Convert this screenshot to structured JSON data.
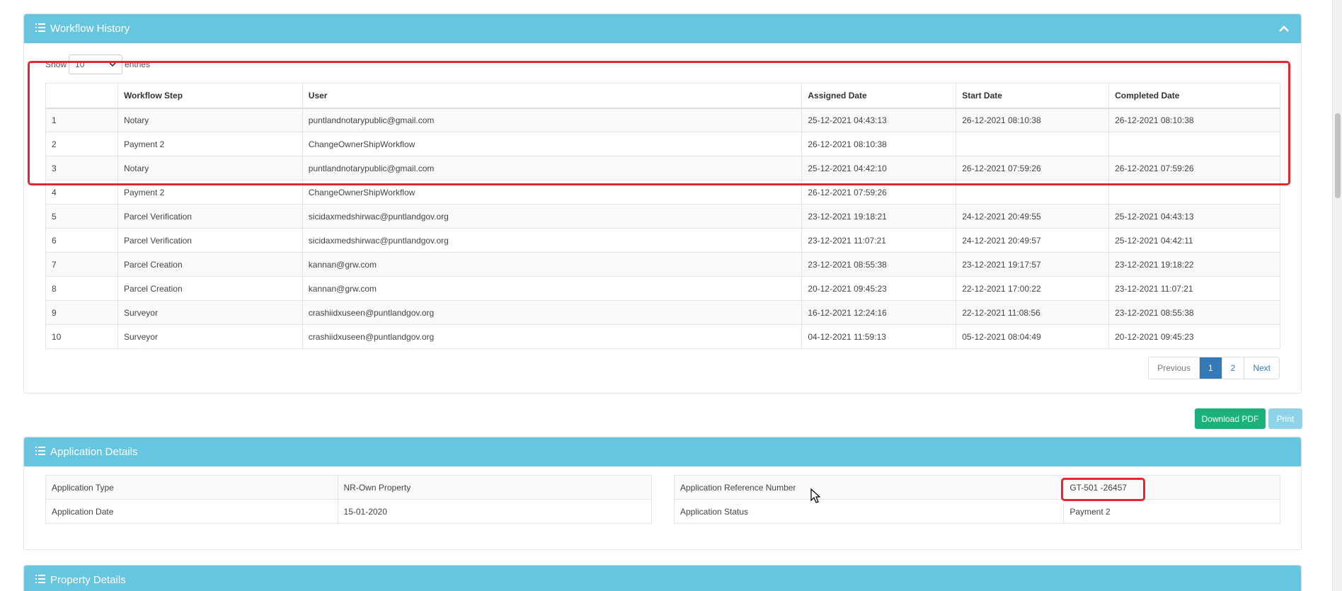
{
  "workflow_history": {
    "title": "Workflow History",
    "show_label": "Show",
    "entries_value": "10",
    "entries_label": "entries",
    "columns": [
      "",
      "Workflow Step",
      "User",
      "Assigned Date",
      "Start Date",
      "Completed Date"
    ],
    "rows": [
      [
        "1",
        "Notary",
        "puntlandnotarypublic@gmail.com",
        "25-12-2021 04:43:13",
        "26-12-2021 08:10:38",
        "26-12-2021 08:10:38"
      ],
      [
        "2",
        "Payment 2",
        "ChangeOwnerShipWorkflow",
        "26-12-2021 08:10:38",
        "",
        ""
      ],
      [
        "3",
        "Notary",
        "puntlandnotarypublic@gmail.com",
        "25-12-2021 04:42:10",
        "26-12-2021 07:59:26",
        "26-12-2021 07:59:26"
      ],
      [
        "4",
        "Payment 2",
        "ChangeOwnerShipWorkflow",
        "26-12-2021 07:59:26",
        "",
        ""
      ],
      [
        "5",
        "Parcel Verification",
        "sicidaxmedshirwac@puntlandgov.org",
        "23-12-2021 19:18:21",
        "24-12-2021 20:49:55",
        "25-12-2021 04:43:13"
      ],
      [
        "6",
        "Parcel Verification",
        "sicidaxmedshirwac@puntlandgov.org",
        "23-12-2021 11:07:21",
        "24-12-2021 20:49:57",
        "25-12-2021 04:42:11"
      ],
      [
        "7",
        "Parcel Creation",
        "kannan@grw.com",
        "23-12-2021 08:55:38",
        "23-12-2021 19:17:57",
        "23-12-2021 19:18:22"
      ],
      [
        "8",
        "Parcel Creation",
        "kannan@grw.com",
        "20-12-2021 09:45:23",
        "22-12-2021 17:00:22",
        "23-12-2021 11:07:21"
      ],
      [
        "9",
        "Surveyor",
        "crashiidxuseen@puntlandgov.org",
        "16-12-2021 12:24:16",
        "22-12-2021 11:08:56",
        "23-12-2021 08:55:38"
      ],
      [
        "10",
        "Surveyor",
        "crashiidxuseen@puntlandgov.org",
        "04-12-2021 11:59:13",
        "05-12-2021 08:04:49",
        "20-12-2021 09:45:23"
      ]
    ],
    "pagination": {
      "previous": "Previous",
      "pages": [
        "1",
        "2"
      ],
      "active": "1",
      "next": "Next"
    }
  },
  "actions": {
    "download_pdf": "Download PDF",
    "print": "Print"
  },
  "application_details": {
    "title": "Application Details",
    "left": [
      {
        "label": "Application Type",
        "value": "NR-Own Property"
      },
      {
        "label": "Application Date",
        "value": "15-01-2020"
      }
    ],
    "right": [
      {
        "label": "Application Reference Number",
        "value": "GT-501 -26457"
      },
      {
        "label": "Application Status",
        "value": "Payment 2"
      }
    ]
  },
  "property_details": {
    "title": "Property Details"
  },
  "colors": {
    "panel_header": "#66c5df",
    "highlight": "#e3282f",
    "primary": "#337ab7",
    "success": "#18b27a"
  }
}
